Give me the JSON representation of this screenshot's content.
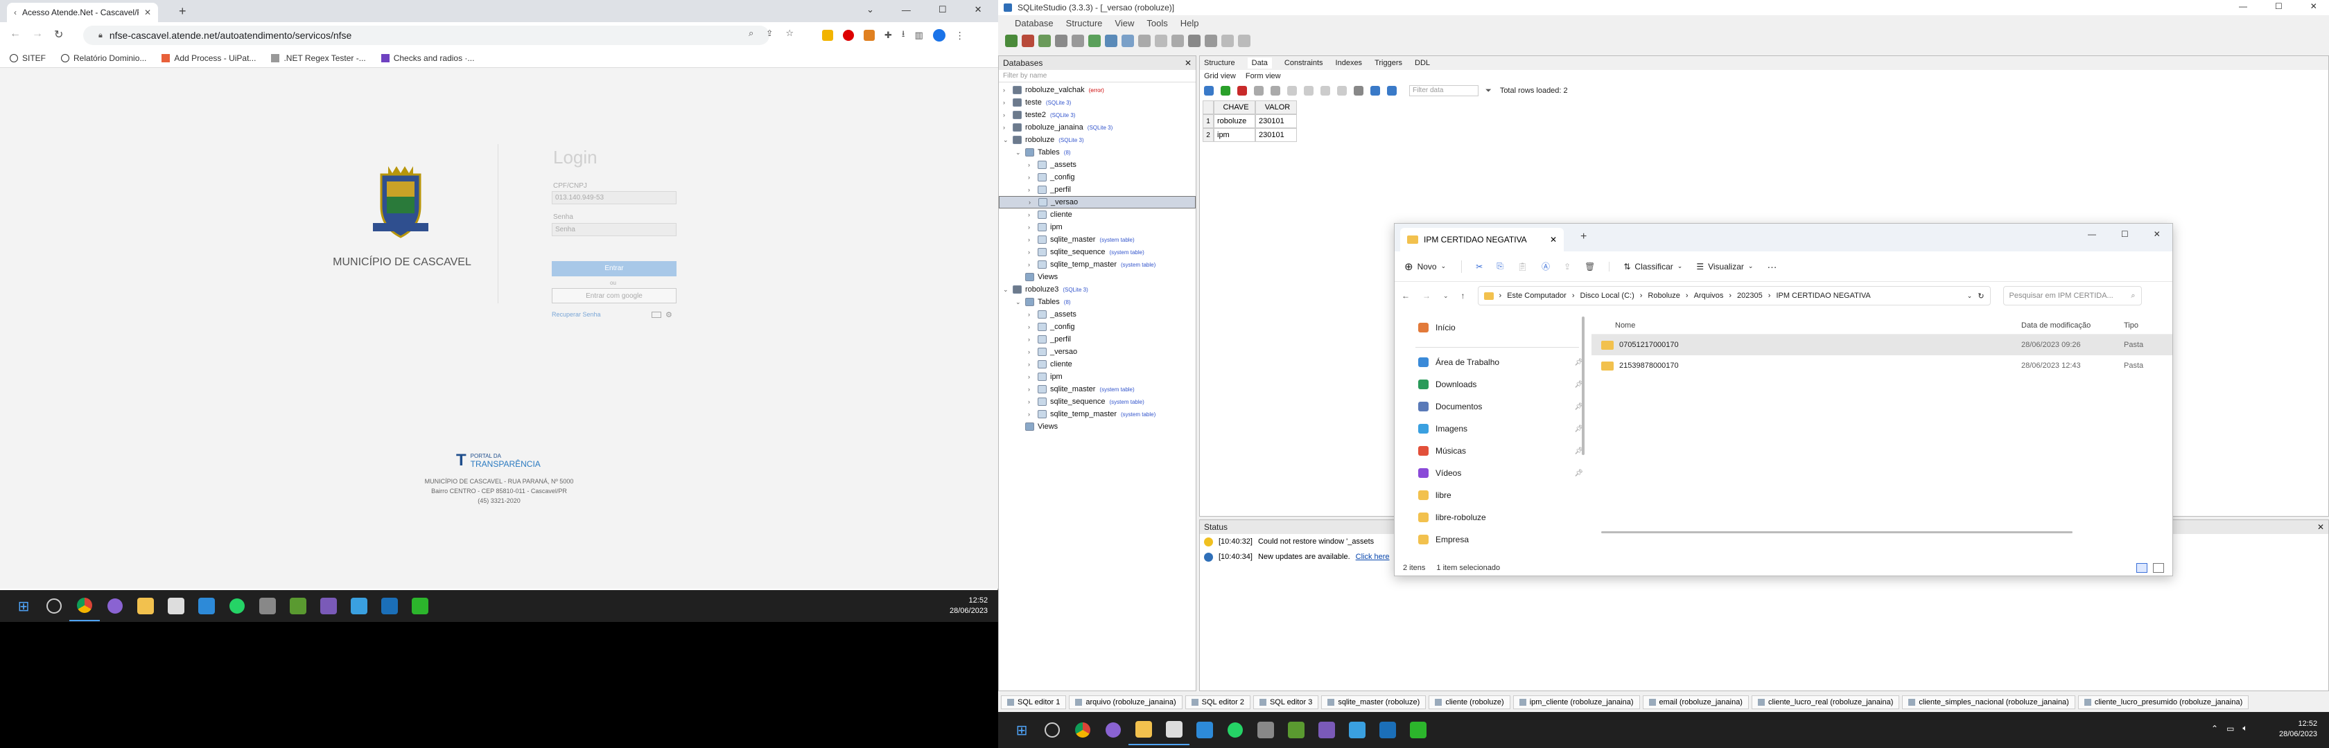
{
  "chrome": {
    "tab_title": "Acesso Atende.Net - Cascavel/PR",
    "url": "nfse-cascavel.atende.net/autoatendimento/servicos/nfse",
    "bookmarks": [
      "SITEF",
      "Relatório Dominio...",
      "Add Process - UiPat...",
      ".NET Regex Tester -...",
      "Checks and radios ·..."
    ],
    "page": {
      "municipality": "MUNICÍPIO DE CASCAVEL",
      "login_title": "Login",
      "cpf_label": "CPF/CNPJ",
      "cpf_value": "013.140.949-53",
      "password_label": "Senha",
      "password_placeholder": "Senha",
      "login_button": "Entrar",
      "ou": "ou",
      "google_button": "Entrar com google",
      "recover": "Recuperar Senha",
      "portal_small": "PORTAL DA",
      "portal_big": "TRANSPARÊNCIA",
      "footer_lines": [
        "MUNICÍPIO DE CASCAVEL - RUA PARANÁ, Nº 5000",
        "Bairro CENTRO - CEP 85810-011 - Cascavel/PR",
        "(45) 3321-2020"
      ]
    },
    "taskbar_time": "12:52",
    "taskbar_date": "28/06/2023"
  },
  "sqlite": {
    "title": "SQLiteStudio (3.3.3) - [_versao (roboluze)]",
    "menu": [
      "Database",
      "Structure",
      "View",
      "Tools",
      "Help"
    ],
    "databases_title": "Databases",
    "filter_placeholder": "Filter by name",
    "tree": [
      {
        "label": "roboluze_valchak",
        "tag": "(error)",
        "indent": 0,
        "twisty": ">"
      },
      {
        "label": "teste",
        "tag": "(SQLite 3)",
        "indent": 0,
        "twisty": ">"
      },
      {
        "label": "teste2",
        "tag": "(SQLite 3)",
        "indent": 0,
        "twisty": ">"
      },
      {
        "label": "roboluze_janaina",
        "tag": "(SQLite 3)",
        "indent": 0,
        "twisty": ">"
      },
      {
        "label": "roboluze",
        "tag": "(SQLite 3)",
        "indent": 0,
        "twisty": "v"
      },
      {
        "label": "Tables",
        "tag": "(8)",
        "indent": 1,
        "twisty": "v"
      },
      {
        "label": "_assets",
        "tag": "",
        "indent": 2,
        "twisty": ">"
      },
      {
        "label": "_config",
        "tag": "",
        "indent": 2,
        "twisty": ">"
      },
      {
        "label": "_perfil",
        "tag": "",
        "indent": 2,
        "twisty": ">"
      },
      {
        "label": "_versao",
        "tag": "",
        "indent": 2,
        "twisty": ">",
        "selected": true
      },
      {
        "label": "cliente",
        "tag": "",
        "indent": 2,
        "twisty": ">"
      },
      {
        "label": "ipm",
        "tag": "",
        "indent": 2,
        "twisty": ">"
      },
      {
        "label": "sqlite_master",
        "tag": "(system table)",
        "indent": 2,
        "twisty": ">"
      },
      {
        "label": "sqlite_sequence",
        "tag": "(system table)",
        "indent": 2,
        "twisty": ">"
      },
      {
        "label": "sqlite_temp_master",
        "tag": "(system table)",
        "indent": 2,
        "twisty": ">"
      },
      {
        "label": "Views",
        "tag": "",
        "indent": 1,
        "twisty": ""
      },
      {
        "label": "roboluze3",
        "tag": "(SQLite 3)",
        "indent": 0,
        "twisty": "v"
      },
      {
        "label": "Tables",
        "tag": "(8)",
        "indent": 1,
        "twisty": "v"
      },
      {
        "label": "_assets",
        "tag": "",
        "indent": 2,
        "twisty": ">"
      },
      {
        "label": "_config",
        "tag": "",
        "indent": 2,
        "twisty": ">"
      },
      {
        "label": "_perfil",
        "tag": "",
        "indent": 2,
        "twisty": ">"
      },
      {
        "label": "_versao",
        "tag": "",
        "indent": 2,
        "twisty": ">"
      },
      {
        "label": "cliente",
        "tag": "",
        "indent": 2,
        "twisty": ">"
      },
      {
        "label": "ipm",
        "tag": "",
        "indent": 2,
        "twisty": ">"
      },
      {
        "label": "sqlite_master",
        "tag": "(system table)",
        "indent": 2,
        "twisty": ">"
      },
      {
        "label": "sqlite_sequence",
        "tag": "(system table)",
        "indent": 2,
        "twisty": ">"
      },
      {
        "label": "sqlite_temp_master",
        "tag": "(system table)",
        "indent": 2,
        "twisty": ">"
      },
      {
        "label": "Views",
        "tag": "",
        "indent": 1,
        "twisty": ""
      }
    ],
    "editor_tabs": [
      "Structure",
      "Data",
      "Constraints",
      "Indexes",
      "Triggers",
      "DDL"
    ],
    "view_tabs": [
      "Grid view",
      "Form view"
    ],
    "filter_data_placeholder": "Filter data",
    "total_rows": "Total rows loaded: 2",
    "grid": {
      "columns": [
        "CHAVE",
        "VALOR"
      ],
      "rows": [
        [
          "roboluze",
          "230101"
        ],
        [
          "ipm",
          "230101"
        ]
      ]
    },
    "status_title": "Status",
    "status_lines": [
      {
        "time": "[10:40:32]",
        "text": "Could not restore window '_assets",
        "kind": "warn"
      },
      {
        "time": "[10:40:34]",
        "text": "New updates are available.",
        "link": "Click here",
        "kind": "info"
      }
    ],
    "bottom_tabs": [
      "SQL editor 1",
      "arquivo (roboluze_janaina)",
      "SQL editor 2",
      "SQL editor 3",
      "sqlite_master (roboluze)",
      "cliente (roboluze)",
      "ipm_cliente (roboluze_janaina)",
      "email (roboluze_janaina)",
      "cliente_lucro_real (roboluze_janaina)",
      "cliente_simples_nacional (roboluze_janaina)",
      "cliente_lucro_presumido (roboluze_janaina)"
    ],
    "taskbar_time": "12:52",
    "taskbar_date": "28/06/2023"
  },
  "explorer": {
    "tab_title": "IPM CERTIDAO NEGATIVA",
    "new_label": "Novo",
    "sort_label": "Classificar",
    "view_label": "Visualizar",
    "breadcrumb": [
      "Este Computador",
      "Disco Local (C:)",
      "Roboluze",
      "Arquivos",
      "202305",
      "IPM CERTIDAO NEGATIVA"
    ],
    "search_placeholder": "Pesquisar em IPM CERTIDA...",
    "nav": [
      {
        "label": "Início",
        "icon": "home-icon",
        "pinned": false
      },
      {
        "label": "Área de Trabalho",
        "icon": "desktop-icon",
        "pinned": true
      },
      {
        "label": "Downloads",
        "icon": "download-icon",
        "pinned": true
      },
      {
        "label": "Documentos",
        "icon": "documents-icon",
        "pinned": true
      },
      {
        "label": "Imagens",
        "icon": "images-icon",
        "pinned": true
      },
      {
        "label": "Músicas",
        "icon": "music-icon",
        "pinned": true
      },
      {
        "label": "Vídeos",
        "icon": "video-icon",
        "pinned": true
      },
      {
        "label": "libre",
        "icon": "folder-icon",
        "pinned": false
      },
      {
        "label": "libre-roboluze",
        "icon": "folder-icon",
        "pinned": false
      },
      {
        "label": "Empresa",
        "icon": "folder-icon",
        "pinned": false
      }
    ],
    "columns": [
      "Nome",
      "Data de modificação",
      "Tipo"
    ],
    "files": [
      {
        "name": "07051217000170",
        "date": "28/06/2023 09:26",
        "type": "Pasta",
        "selected": true
      },
      {
        "name": "21539878000170",
        "date": "28/06/2023 12:43",
        "type": "Pasta",
        "selected": false
      }
    ],
    "status_items": "2 itens",
    "status_selected": "1 item selecionado"
  }
}
